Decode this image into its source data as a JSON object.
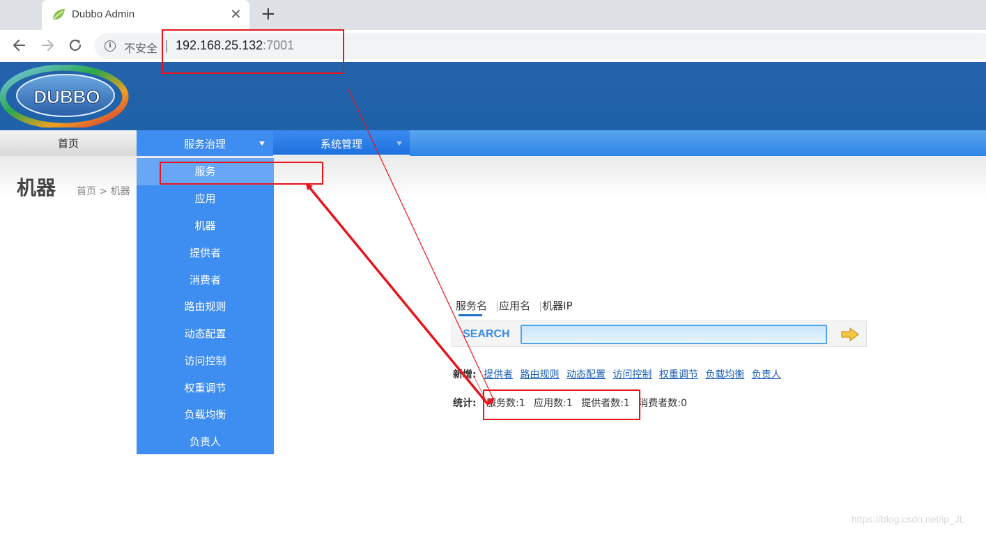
{
  "browser": {
    "tab_title": "Dubbo Admin",
    "close_glyph": "✕",
    "newtab_glyph": "+",
    "insecure_label": "不安全",
    "separator": "|",
    "url_host": "192.168.25.132",
    "url_port": ":7001",
    "info_glyph": "i"
  },
  "nav": {
    "home": "首页",
    "service_governance": "服务治理",
    "system_management": "系统管理"
  },
  "page": {
    "title": "机器",
    "breadcrumb": "首页 > 机器"
  },
  "dropdown": {
    "items": [
      {
        "label": "服务"
      },
      {
        "label": "应用"
      },
      {
        "label": "机器"
      },
      {
        "label": "提供者"
      },
      {
        "label": "消费者"
      },
      {
        "label": "路由规则"
      },
      {
        "label": "动态配置"
      },
      {
        "label": "访问控制"
      },
      {
        "label": "权重调节"
      },
      {
        "label": "负载均衡"
      },
      {
        "label": "负责人"
      }
    ]
  },
  "search": {
    "tabs": [
      "服务名",
      "应用名",
      "机器IP"
    ],
    "tab_separator": "|",
    "label": "SEARCH",
    "value": ""
  },
  "add": {
    "label": "新增:",
    "links": [
      "提供者",
      "路由规则",
      "动态配置",
      "访问控制",
      "权重调节",
      "负载均衡",
      "负责人"
    ]
  },
  "stats": {
    "label": "统计:",
    "services": "服务数:1",
    "apps": "应用数:1",
    "providers": "提供者数:1",
    "consumers": "消费者数:0"
  },
  "watermark": "https://blog.csdn.net/ip_JL",
  "colors": {
    "header_blue": "#2463ac",
    "menu_blue": "#3e8df0",
    "annotation_red": "#e8141c",
    "link_blue": "#1a5fb4"
  }
}
